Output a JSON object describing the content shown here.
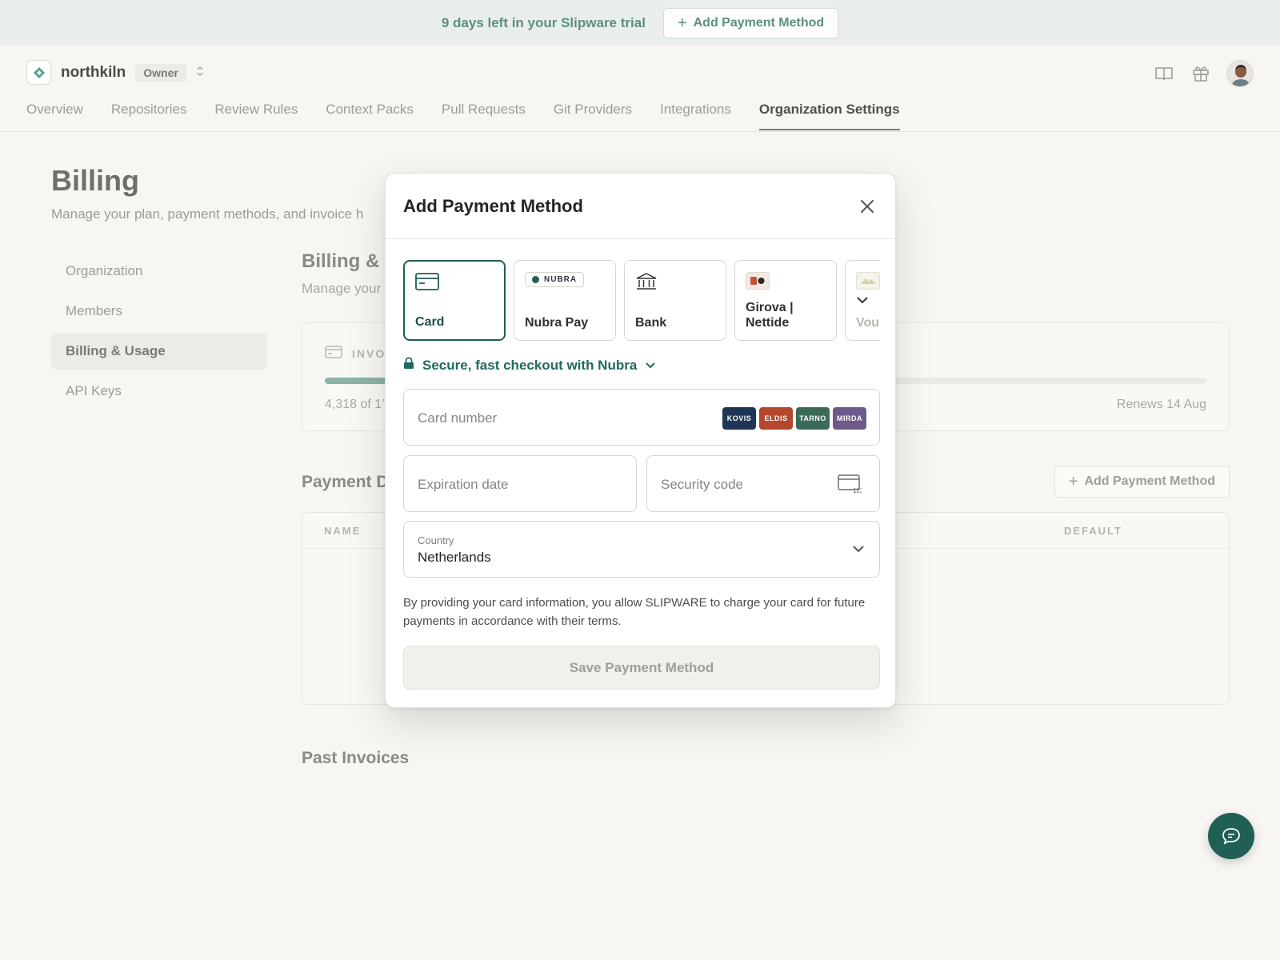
{
  "trial": {
    "text": "9 days left in your Slipware trial",
    "button": "Add Payment Method"
  },
  "org": {
    "name": "northkiln",
    "role": "Owner"
  },
  "tabs": [
    "Overview",
    "Repositories",
    "Review Rules",
    "Context Packs",
    "Pull Requests",
    "Git Providers",
    "Integrations",
    "Organization Settings"
  ],
  "active_tab": "Organization Settings",
  "page": {
    "title": "Billing",
    "subtitle": "Manage your plan, payment methods, and invoice h"
  },
  "sidenav": [
    "Organization",
    "Members",
    "Billing & Usage",
    "API Keys"
  ],
  "active_sidenav": "Billing & Usage",
  "billing": {
    "title": "Billing & U",
    "subtitle": "Manage your",
    "usage_label": "INVO",
    "usage_count": "4,318 of 1’",
    "renews": "Renews 14 Aug",
    "usage_fraction": 0.39
  },
  "payment_details": {
    "title": "Payment D",
    "add_button": "Add Payment Method",
    "columns": {
      "name": "NAME",
      "default": "DEFAULT"
    }
  },
  "past_invoices": "Past Invoices",
  "modal": {
    "title": "Add Payment Method",
    "methods": [
      {
        "label": "Card",
        "icon": "credit-card-icon"
      },
      {
        "label": "Nubra Pay",
        "badge": "NUBRA",
        "icon": "nubra-logo-icon"
      },
      {
        "label": "Bank",
        "icon": "bank-icon"
      },
      {
        "label": "Girova |\nNettide",
        "icon": "girova-logo-icon"
      },
      {
        "label": "Vou",
        "icon": "voucher-icon"
      }
    ],
    "secure_text": "Secure, fast checkout with Nubra",
    "card_number_placeholder": "Card number",
    "card_brands": [
      "KOVIS",
      "ELDIS",
      "TARNO",
      "MIRDA"
    ],
    "card_brand_colors": [
      "#1e3556",
      "#b4472d",
      "#3c6a56",
      "#6e5a8a"
    ],
    "expiration_placeholder": "Expiration date",
    "security_placeholder": "Security code",
    "security_icon_text": "123",
    "country_label": "Country",
    "country_value": "Netherlands",
    "consent": "By providing your card information, you allow SLIPWARE to charge your card for future payments in accordance with their terms.",
    "save_button": "Save Payment Method"
  },
  "colors": {
    "accent": "#1f5f55",
    "trial_text": "#5c8f80"
  }
}
